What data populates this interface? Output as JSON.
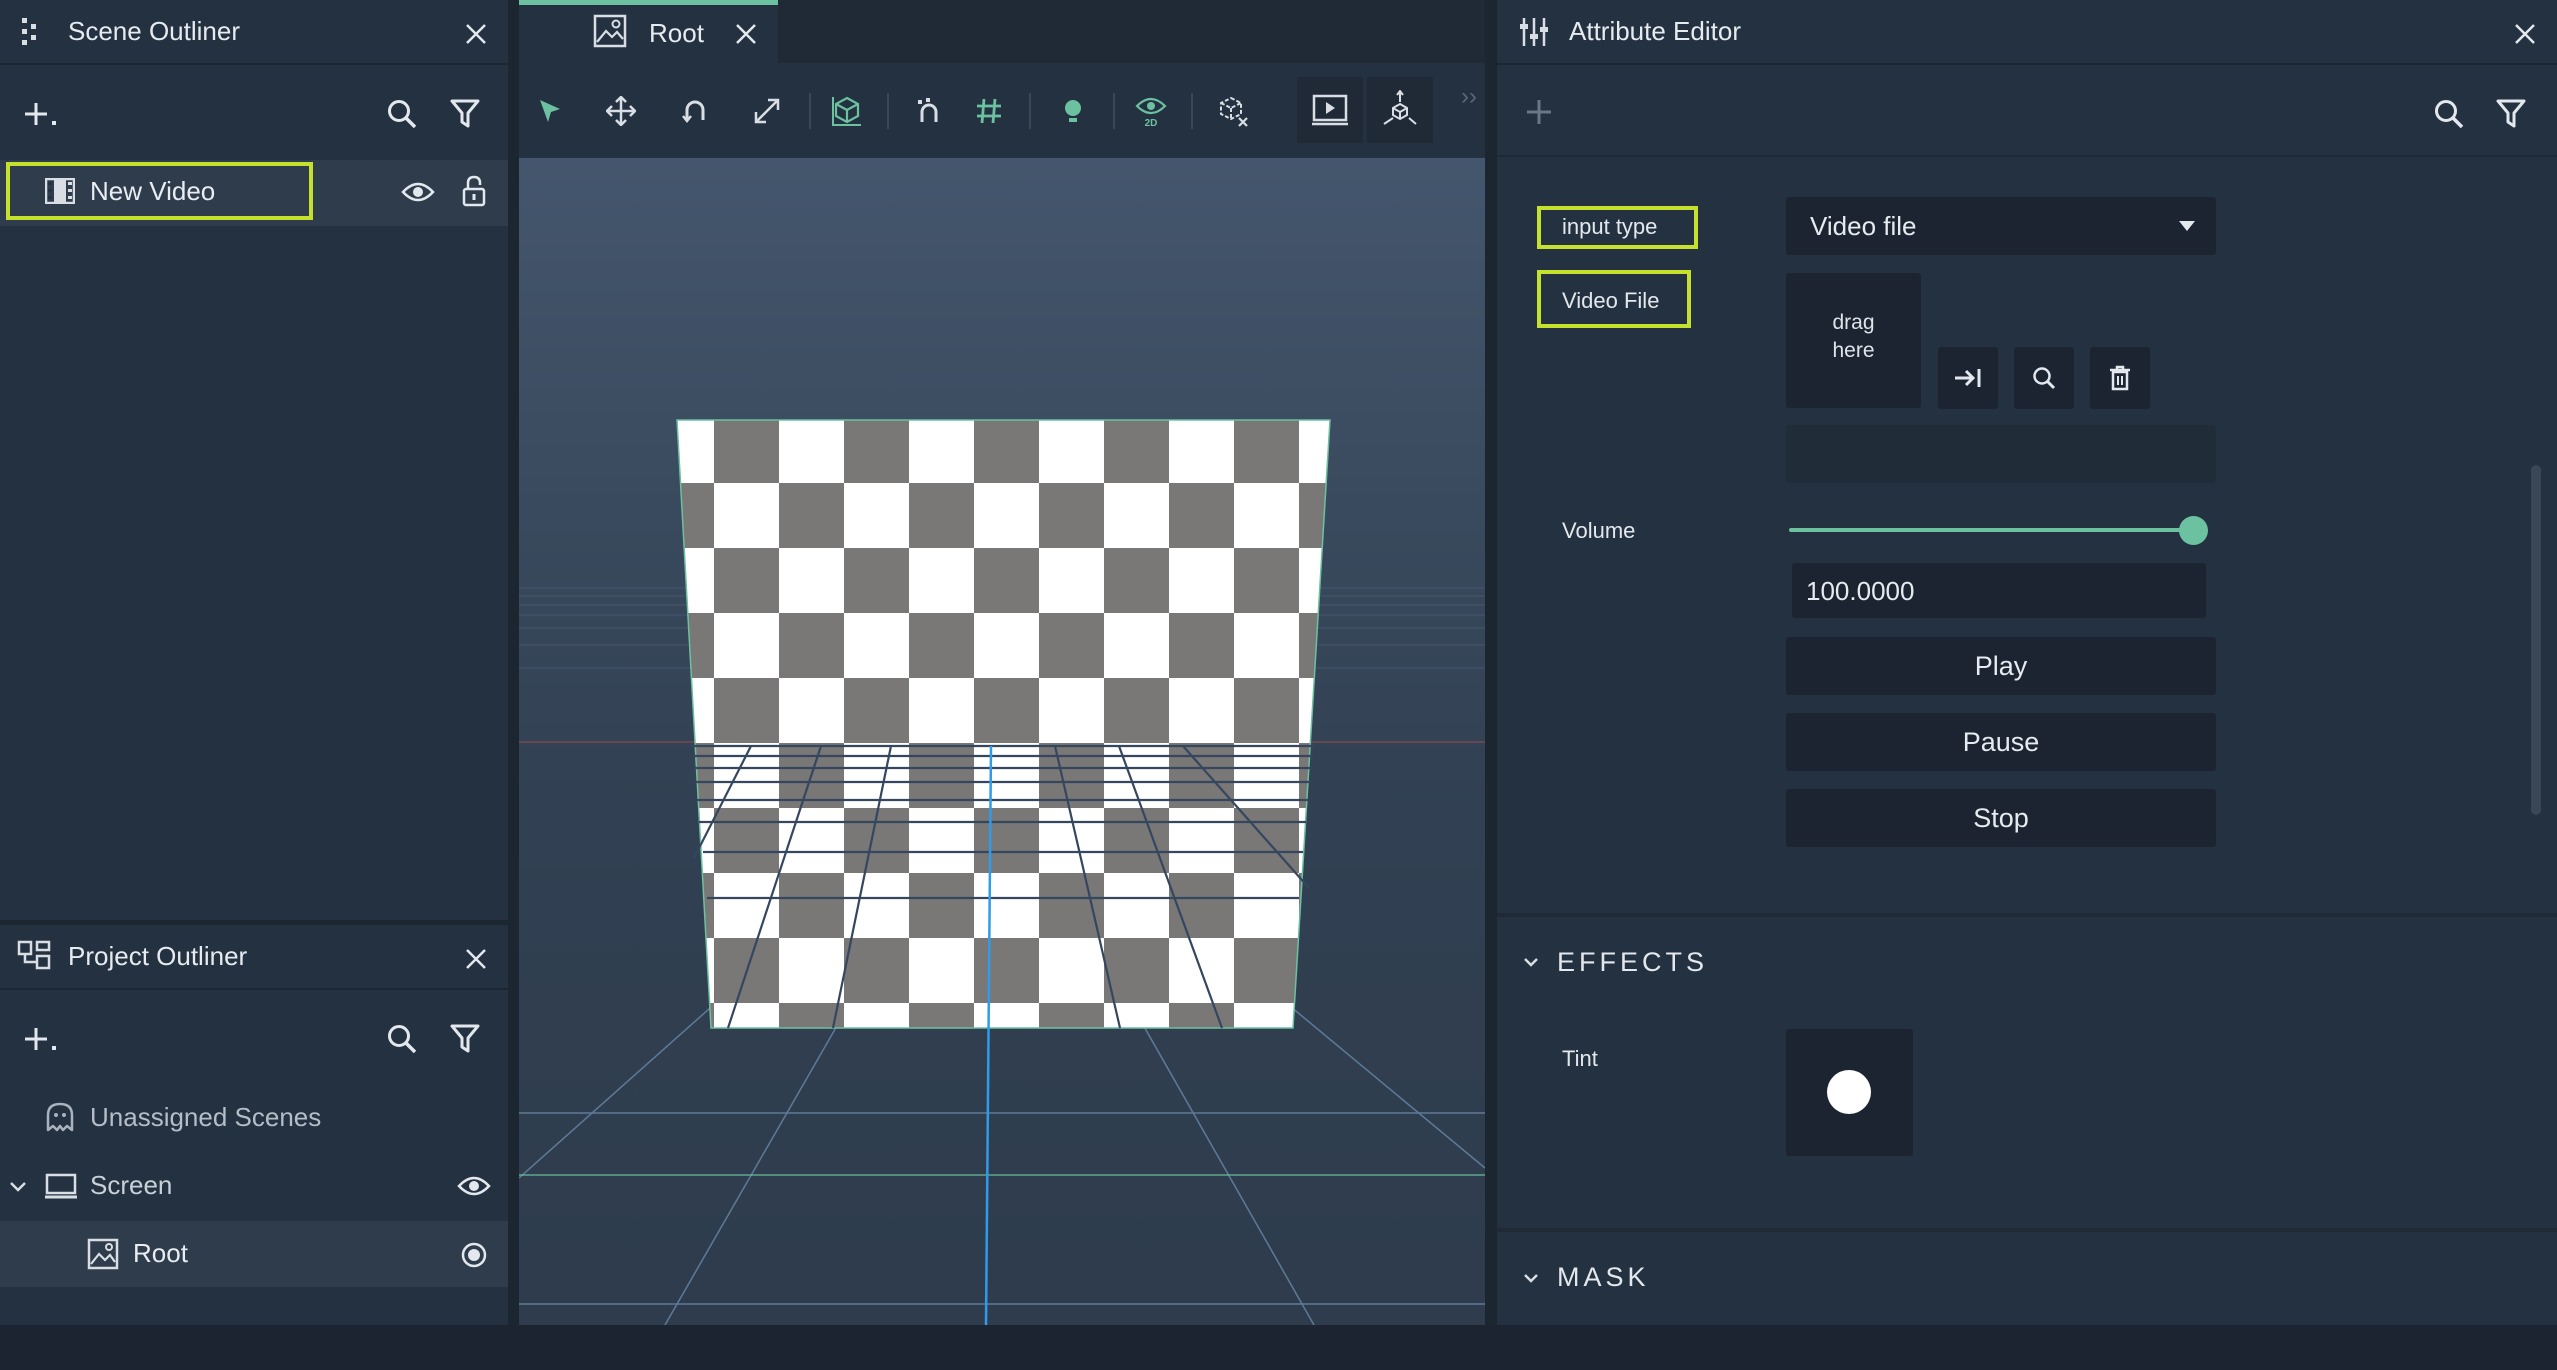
{
  "scene_outliner": {
    "title": "Scene Outliner",
    "items": [
      {
        "label": "New Video"
      }
    ]
  },
  "project_outliner": {
    "title": "Project Outliner",
    "items": [
      {
        "label": "Unassigned Scenes"
      },
      {
        "label": "Screen"
      },
      {
        "label": "Root"
      }
    ]
  },
  "viewport": {
    "tab_label": "Root",
    "toolbar_icons": [
      "select-arrow-icon",
      "move-icon",
      "rotate-icon",
      "scale-icon",
      "object-cube-icon",
      "snap-icon",
      "grid-snap-icon",
      "light-icon",
      "view-2d-icon",
      "clear-cube-icon",
      "preview-play-icon",
      "gizmo-icon"
    ],
    "overflow_label": "››"
  },
  "attribute_editor": {
    "title": "Attribute Editor",
    "input_type_label": "input type",
    "input_type_value": "Video file",
    "video_file_label": "Video File",
    "drag_here_line1": "drag",
    "drag_here_line2": "here",
    "volume_label": "Volume",
    "volume_value": "100.0000",
    "volume_fraction": 1.0,
    "play_label": "Play",
    "pause_label": "Pause",
    "stop_label": "Stop",
    "effects_label": "EFFECTS",
    "tint_label": "Tint",
    "mask_label": "MASK"
  },
  "colors": {
    "panel": "#243140",
    "highlight": "#c6e02e",
    "accent_green": "#6cc1a0",
    "field_dark": "#1b2430"
  }
}
